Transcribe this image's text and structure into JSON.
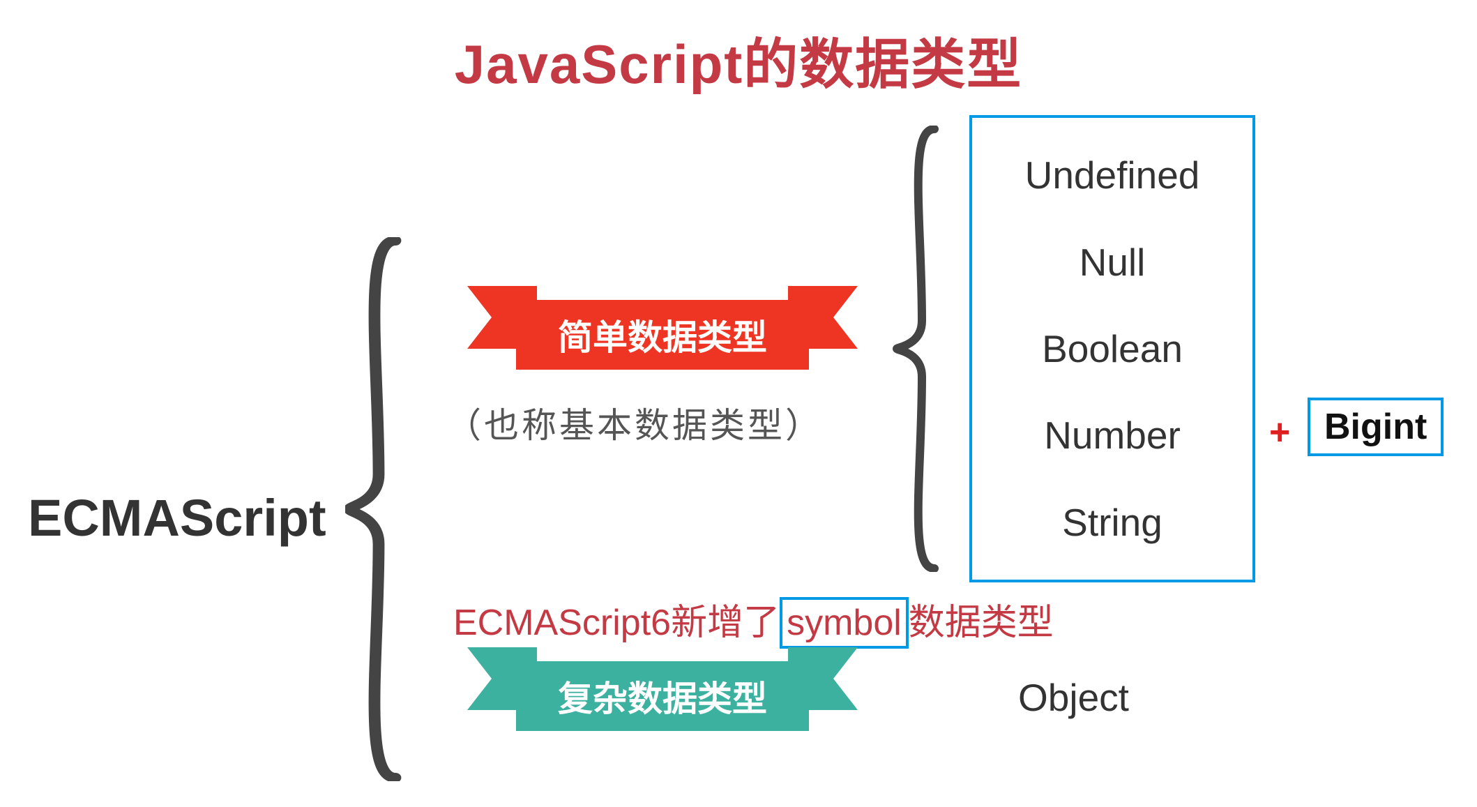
{
  "title": "JavaScript的数据类型",
  "root": "ECMAScript",
  "simple": {
    "label": "简单数据类型",
    "subtitle": "（也称基本数据类型）",
    "types": [
      "Undefined",
      "Null",
      "Boolean",
      "Number",
      "String"
    ],
    "plus": "+",
    "extra": "Bigint"
  },
  "es6_note": {
    "prefix": "ECMAScript6新增了",
    "symbol": "symbol",
    "suffix": "数据类型"
  },
  "complex": {
    "label": "复杂数据类型",
    "type": "Object"
  },
  "colors": {
    "title": "#c33a44",
    "red_ribbon": "#ee3524",
    "green_ribbon": "#3cb1a0",
    "blue_border": "#0099e5"
  }
}
